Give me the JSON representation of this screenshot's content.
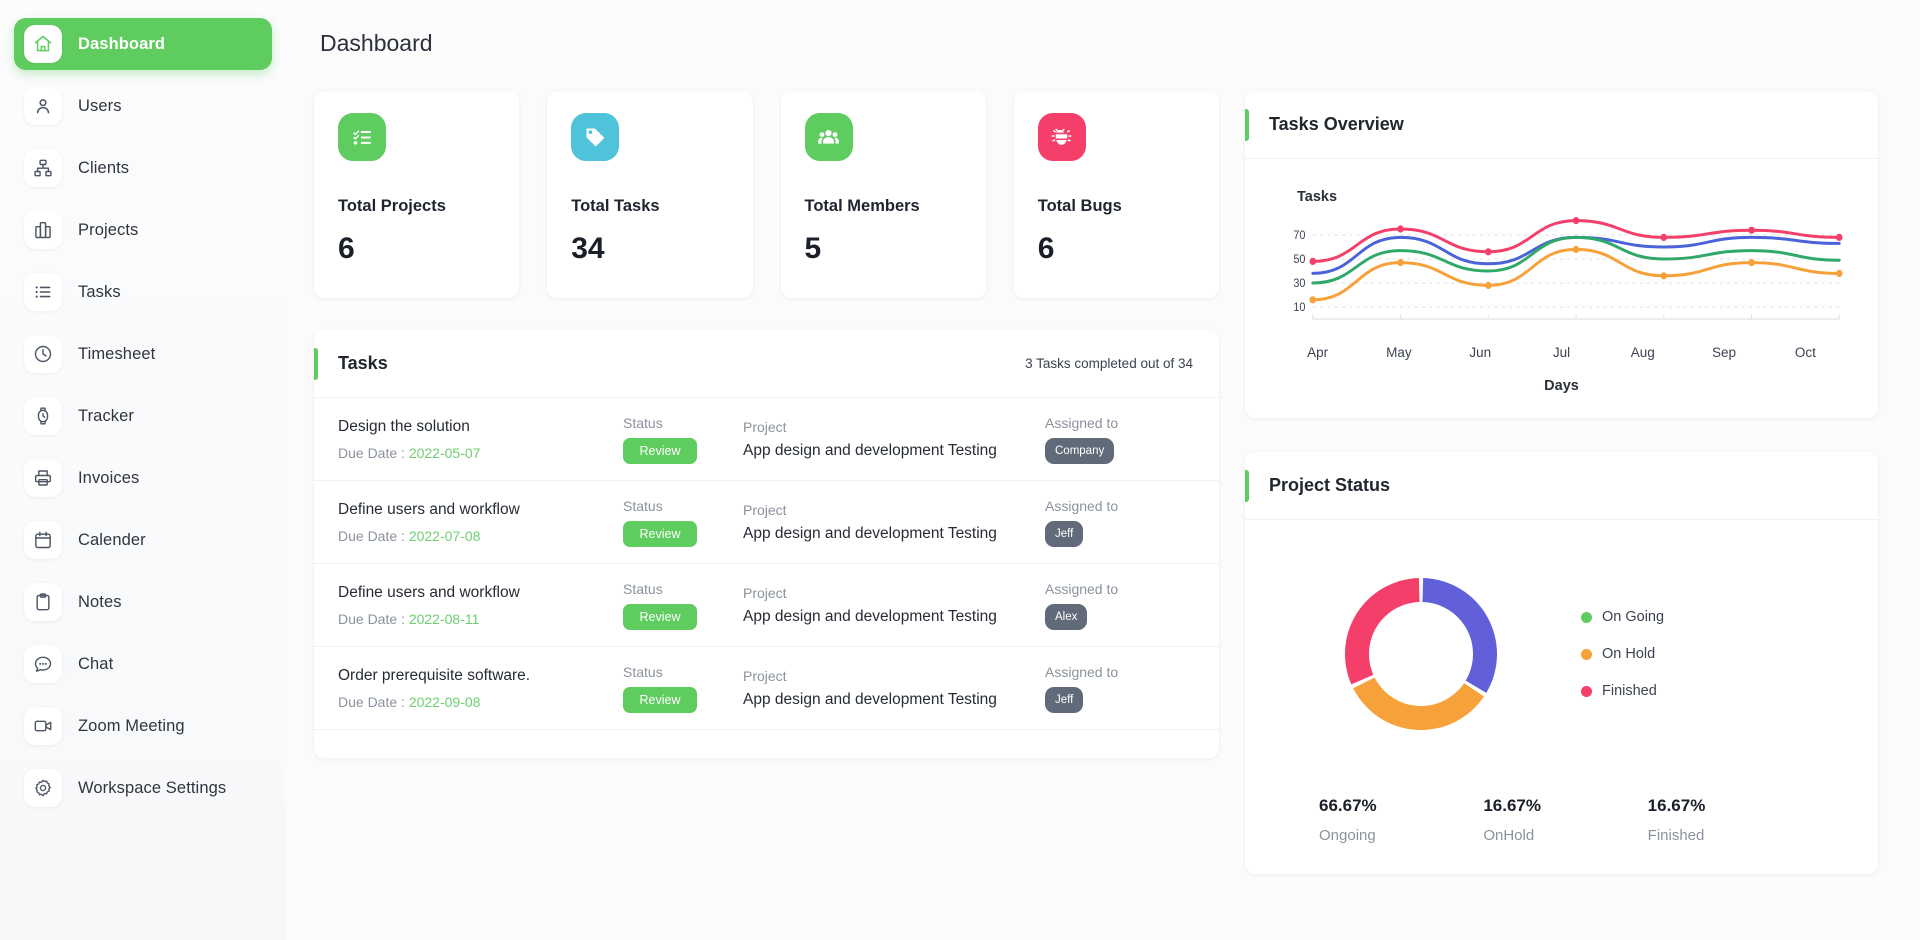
{
  "sidebar": {
    "items": [
      {
        "label": "Dashboard",
        "icon": "home-icon",
        "active": true
      },
      {
        "label": "Users",
        "icon": "user-icon",
        "active": false
      },
      {
        "label": "Clients",
        "icon": "sitemap-icon",
        "active": false
      },
      {
        "label": "Projects",
        "icon": "building-icon",
        "active": false
      },
      {
        "label": "Tasks",
        "icon": "list-icon",
        "active": false
      },
      {
        "label": "Timesheet",
        "icon": "clock-icon",
        "active": false
      },
      {
        "label": "Tracker",
        "icon": "watch-icon",
        "active": false
      },
      {
        "label": "Invoices",
        "icon": "printer-icon",
        "active": false
      },
      {
        "label": "Calender",
        "icon": "calendar-icon",
        "active": false
      },
      {
        "label": "Notes",
        "icon": "clipboard-icon",
        "active": false
      },
      {
        "label": "Chat",
        "icon": "chat-bubble-icon",
        "active": false
      },
      {
        "label": "Zoom Meeting",
        "icon": "video-camera-icon",
        "active": false
      },
      {
        "label": "Workspace Settings",
        "icon": "gear-icon",
        "active": false
      }
    ]
  },
  "header": {
    "title": "Dashboard"
  },
  "stats": [
    {
      "label": "Total Projects",
      "value": "6",
      "icon": "checklist-icon",
      "color": "#5ecc5e"
    },
    {
      "label": "Total Tasks",
      "value": "34",
      "icon": "tag-icon",
      "color": "#4ec3d9"
    },
    {
      "label": "Total Members",
      "value": "5",
      "icon": "people-icon",
      "color": "#5ecc5e"
    },
    {
      "label": "Total Bugs",
      "value": "6",
      "icon": "bug-icon",
      "color": "#f43f6a"
    }
  ],
  "tasks_panel": {
    "title": "Tasks",
    "meta": "3 Tasks completed out of 34",
    "captions": {
      "status": "Status",
      "project": "Project",
      "assigned": "Assigned to",
      "due_prefix": "Due Date : "
    },
    "rows": [
      {
        "title": "Design the solution",
        "due": "2022-05-07",
        "status": "Review",
        "project": "App design and development Testing",
        "assignee": "Company"
      },
      {
        "title": "Define users and workflow",
        "due": "2022-07-08",
        "status": "Review",
        "project": "App design and development Testing",
        "assignee": "Jeff"
      },
      {
        "title": "Define users and workflow",
        "due": "2022-08-11",
        "status": "Review",
        "project": "App design and development Testing",
        "assignee": "Alex"
      },
      {
        "title": "Order prerequisite software.",
        "due": "2022-09-08",
        "status": "Review",
        "project": "App design and development Testing",
        "assignee": "Jeff"
      }
    ]
  },
  "tasks_overview": {
    "title": "Tasks Overview"
  },
  "project_status": {
    "title": "Project Status",
    "legend": [
      {
        "label": "On Going",
        "color": "#5ecc5e"
      },
      {
        "label": "On Hold",
        "color": "#f7a13a"
      },
      {
        "label": "Finished",
        "color": "#f43f6a"
      }
    ],
    "percentages": [
      {
        "value": "66.67%",
        "label": "Ongoing"
      },
      {
        "value": "16.67%",
        "label": "OnHold"
      },
      {
        "value": "16.67%",
        "label": "Finished"
      }
    ]
  },
  "chart_data": [
    {
      "type": "line",
      "title": "Tasks Overview",
      "xlabel": "Days",
      "ylabel": "Tasks",
      "ylim": [
        0,
        80
      ],
      "yticks": [
        10,
        30,
        50,
        70
      ],
      "grid": true,
      "legend": "none",
      "categories": [
        "Apr",
        "May",
        "Jun",
        "Jul",
        "Aug",
        "Sep",
        "Oct"
      ],
      "series": [
        {
          "name": "series-pink",
          "color": "#f43f6a",
          "values": [
            48,
            75,
            56,
            82,
            68,
            74,
            68
          ]
        },
        {
          "name": "series-blue",
          "color": "#4a63d8",
          "values": [
            38,
            68,
            46,
            68,
            60,
            68,
            63
          ]
        },
        {
          "name": "series-green",
          "color": "#2fa86a",
          "values": [
            30,
            57,
            40,
            68,
            50,
            57,
            49
          ]
        },
        {
          "name": "series-orange",
          "color": "#f7a13a",
          "values": [
            16,
            47,
            28,
            58,
            36,
            47,
            38
          ]
        }
      ]
    },
    {
      "type": "pie",
      "title": "Project Status",
      "labels": [
        "On Going",
        "On Hold",
        "Finished"
      ],
      "values": [
        66.67,
        16.67,
        16.67
      ],
      "display_percent": [
        "66.67%",
        "16.67%",
        "16.67%"
      ],
      "slice_colors": [
        "#6260d8",
        "#f7a13a",
        "#f43f6a"
      ],
      "donut": true,
      "legend": "right"
    }
  ]
}
